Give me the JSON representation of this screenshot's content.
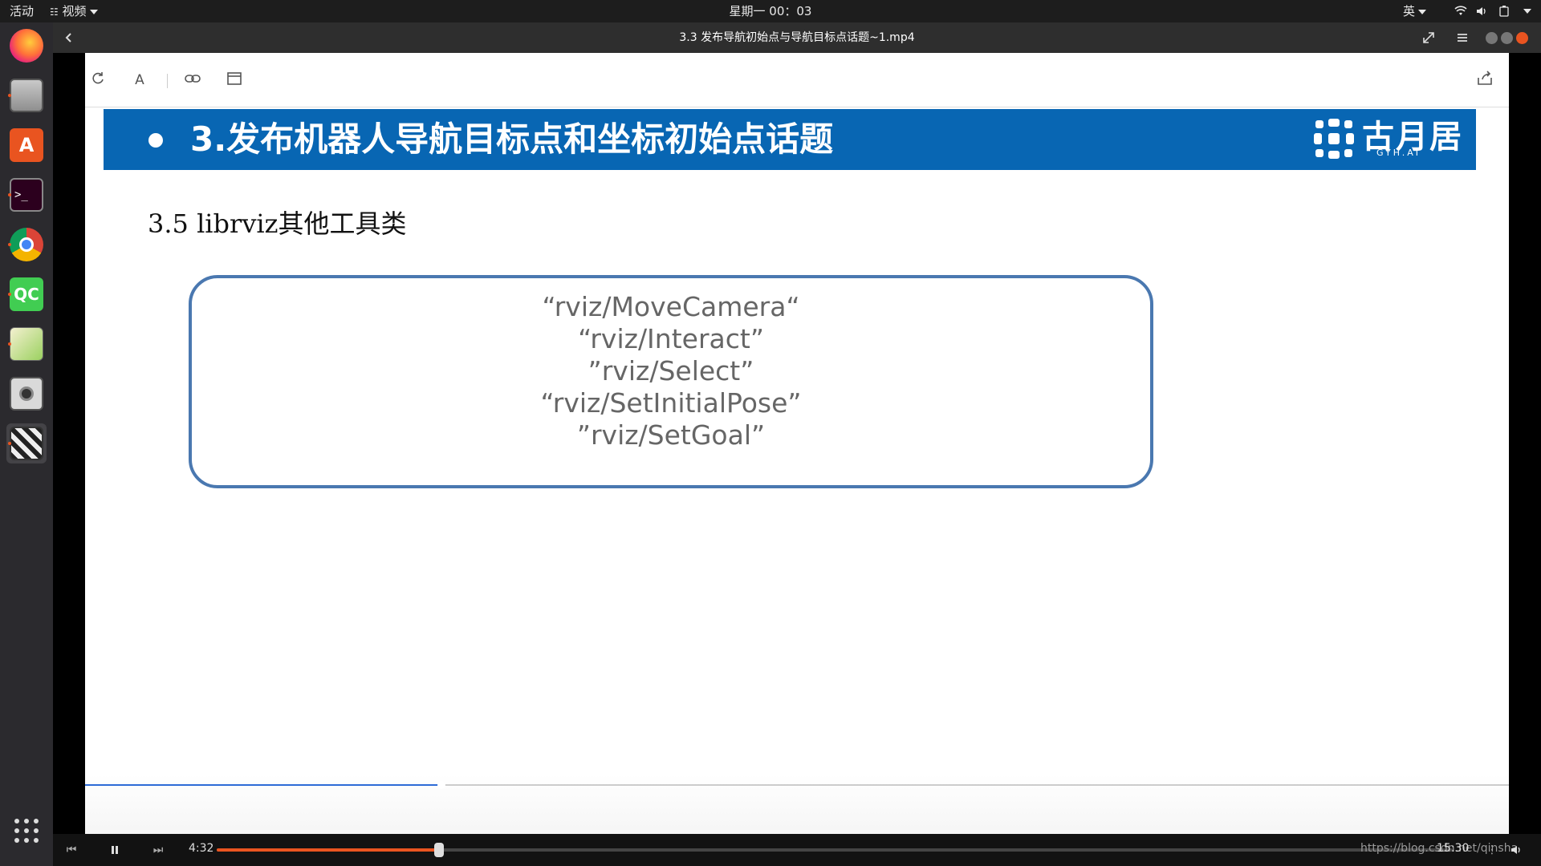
{
  "topbar": {
    "activities": "活动",
    "app_menu": "视频",
    "clock": "星期一 00：03",
    "lang": "英"
  },
  "window": {
    "title": "3.3 发布导航初始点与导航目标点话题~1.mp4"
  },
  "slide": {
    "title": "3.发布机器人导航目标点和坐标初始点话题",
    "logo_text": "古月居",
    "logo_sub": "GYH.AI",
    "section": "3.5 librviz其他工具类",
    "tools": [
      "“rviz/MoveCamera“",
      "“rviz/Interact”",
      "”rviz/Select”",
      "“rviz/SetInitialPose”",
      "”rviz/SetGoal”"
    ],
    "inner_progress": 0.25
  },
  "player": {
    "current_time": "4:32",
    "total_time": "15:30",
    "watermark": "https://blog.csdn.net/qinsha",
    "progress": 0.18
  },
  "colors": {
    "header_blue": "#0866b3",
    "box_border": "#4a78b0",
    "accent": "#e95420"
  }
}
